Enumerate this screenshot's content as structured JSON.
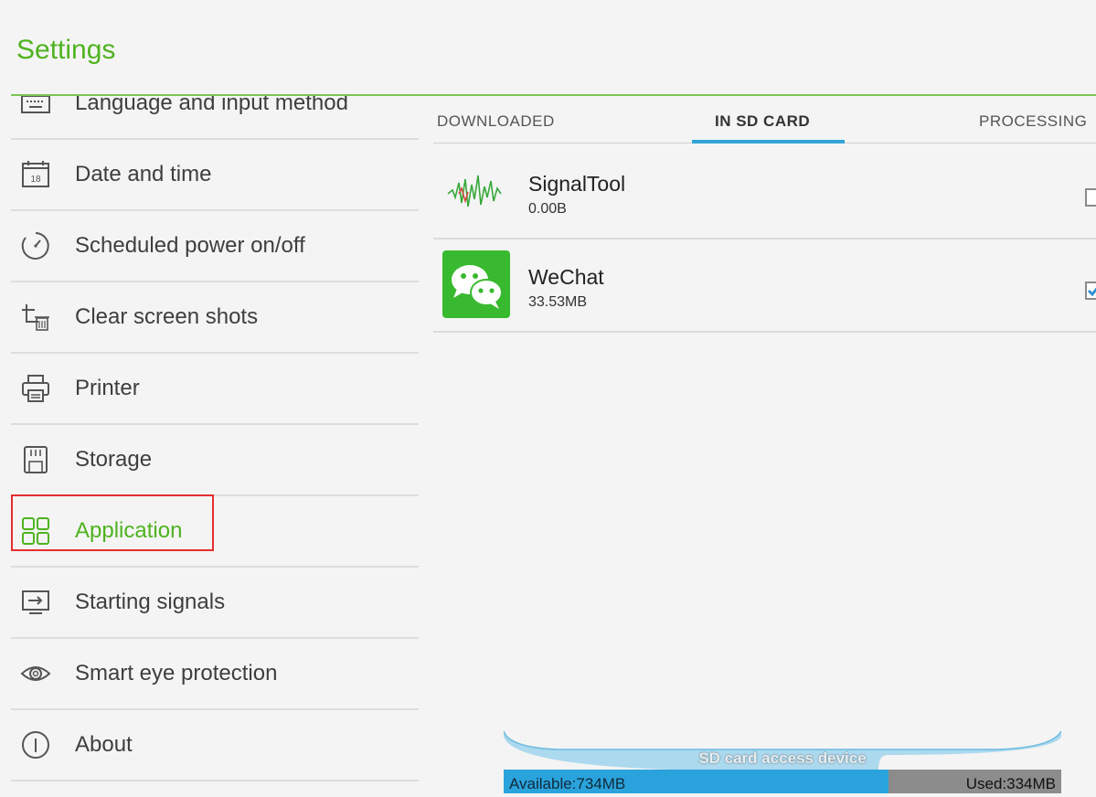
{
  "header": {
    "title": "Settings"
  },
  "sidebar": {
    "items": [
      {
        "label": "Language and input method",
        "icon": "keyboard-icon"
      },
      {
        "label": "Date and time",
        "icon": "calendar-icon",
        "calendar_day": "18"
      },
      {
        "label": "Scheduled power on/off",
        "icon": "timer-icon"
      },
      {
        "label": "Clear screen shots",
        "icon": "crop-trash-icon"
      },
      {
        "label": "Printer",
        "icon": "printer-icon"
      },
      {
        "label": "Storage",
        "icon": "sd-card-icon"
      },
      {
        "label": "Application",
        "icon": "grid-icon",
        "active": true
      },
      {
        "label": "Starting signals",
        "icon": "input-signal-icon"
      },
      {
        "label": "Smart eye protection",
        "icon": "eye-icon"
      },
      {
        "label": "About",
        "icon": "info-icon"
      }
    ]
  },
  "tabs": [
    {
      "label": "DOWNLOADED"
    },
    {
      "label": "IN SD CARD",
      "active": true
    },
    {
      "label": "PROCESSING"
    }
  ],
  "apps": [
    {
      "name": "SignalTool",
      "size": "0.00B",
      "icon": "signal-waveform-icon",
      "checked": false
    },
    {
      "name": "WeChat",
      "size": "33.53MB",
      "icon": "wechat-icon",
      "checked": true
    }
  ],
  "storage": {
    "label": "SD card access device",
    "available": "Available:734MB",
    "used": "Used:334MB",
    "used_fraction": 0.31
  },
  "colors": {
    "accent_green": "#4fb31f",
    "tab_indicator": "#2fa4d7",
    "available_bar": "#2aa3dc",
    "used_bar": "#8c8c8c",
    "highlight_border": "#e62e2e"
  }
}
